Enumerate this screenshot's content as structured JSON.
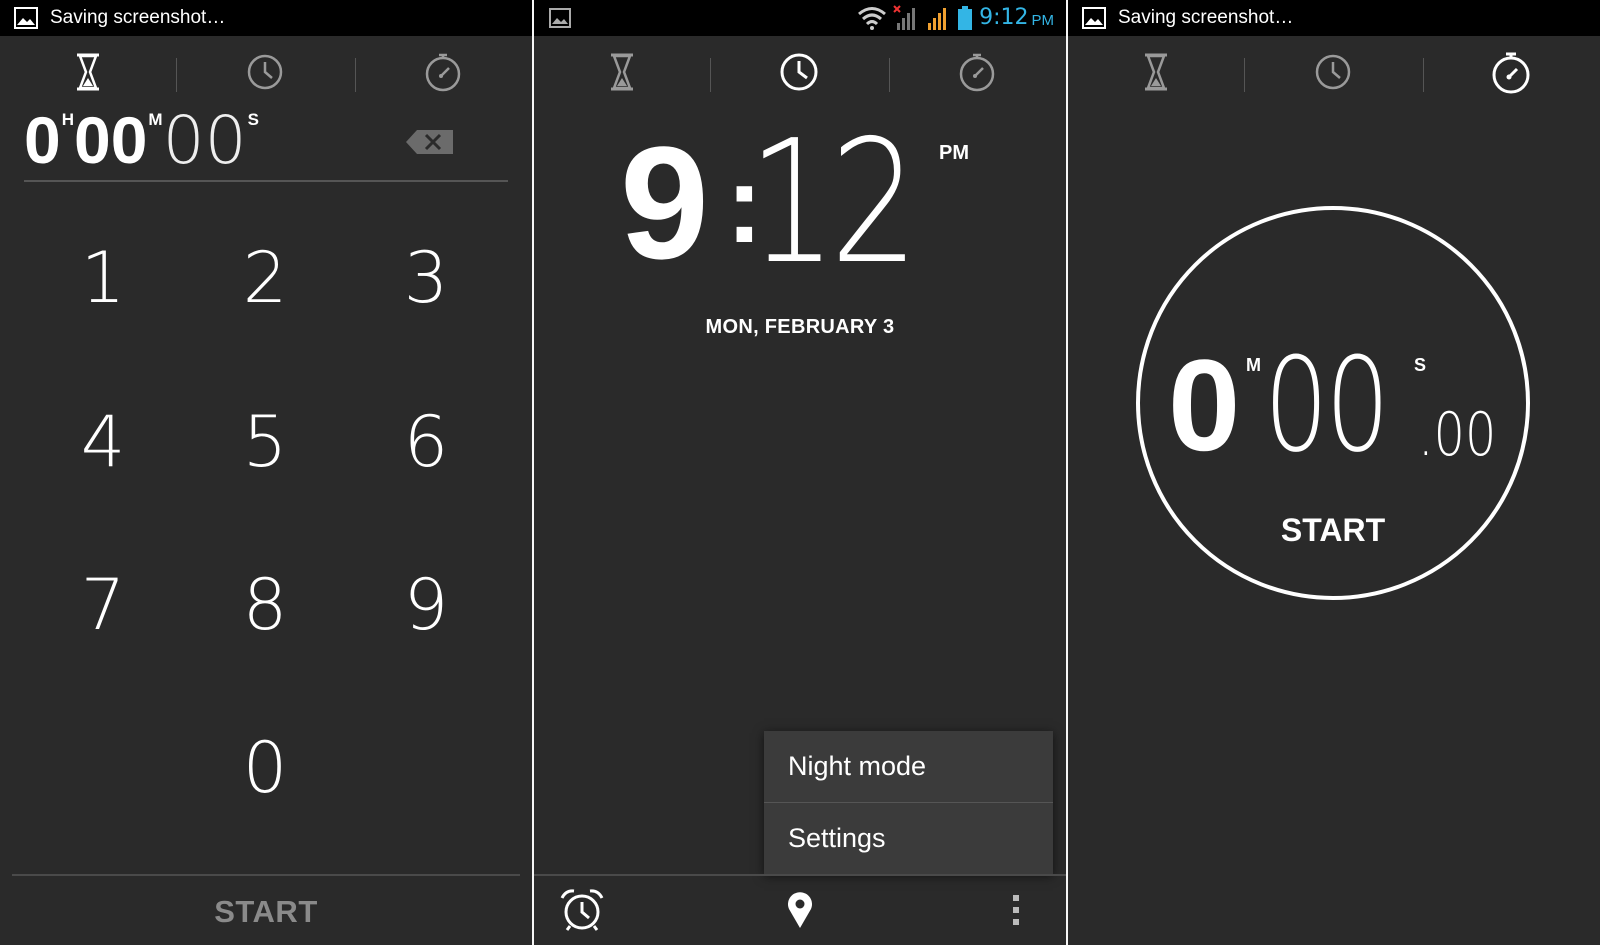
{
  "timer_screen": {
    "status": {
      "text": "Saving screenshot…"
    },
    "display": {
      "hours": "0",
      "hours_unit": "H",
      "minutes": "00",
      "minutes_unit": "M",
      "seconds": "00",
      "seconds_unit": "S"
    },
    "keypad": [
      "1",
      "2",
      "3",
      "4",
      "5",
      "6",
      "7",
      "8",
      "9",
      "0"
    ],
    "start_label": "START"
  },
  "clock_screen": {
    "status": {
      "time": "9:12",
      "ampm": "PM"
    },
    "time": {
      "hour": "9",
      "separator": ":",
      "minutes": "12",
      "ampm": "PM"
    },
    "date": "MON, FEBRUARY 3",
    "menu": {
      "items": [
        "Night mode",
        "Settings"
      ]
    }
  },
  "stopwatch_screen": {
    "status": {
      "text": "Saving screenshot…"
    },
    "display": {
      "minutes": "0",
      "minutes_unit": "M",
      "seconds": "00",
      "seconds_unit": "S",
      "hundredths": ".00"
    },
    "start_label": "START"
  },
  "colors": {
    "background": "#2a2a2a",
    "statusbar": "#000000",
    "accent": "#33b5e5",
    "menu": "#3b3b3b"
  },
  "icons": [
    "image-icon",
    "hourglass-icon",
    "clock-icon",
    "stopwatch-icon",
    "backspace-icon",
    "wifi-icon",
    "signal-icon",
    "battery-icon",
    "alarm-icon",
    "location-pin-icon",
    "overflow-menu-icon"
  ]
}
